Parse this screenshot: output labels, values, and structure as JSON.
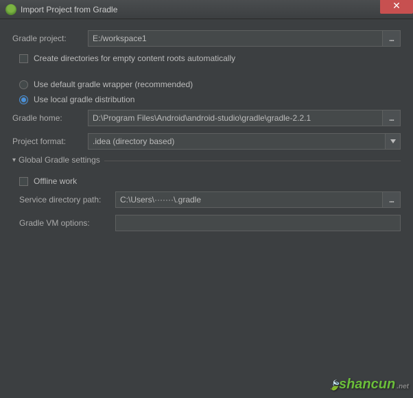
{
  "window": {
    "title": "Import Project from Gradle",
    "close": "✕"
  },
  "gradleProject": {
    "label": "Gradle project:",
    "value": "E:/workspace1",
    "browse": "..."
  },
  "createDirs": {
    "label": "Create directories for empty content roots automatically"
  },
  "wrapperOption": {
    "label": "Use default gradle wrapper (recommended)"
  },
  "localOption": {
    "label": "Use local gradle distribution"
  },
  "gradleHome": {
    "label": "Gradle home:",
    "value": "D:\\Program Files\\Android\\android-studio\\gradle\\gradle-2.2.1",
    "browse": "..."
  },
  "projectFormat": {
    "label": "Project format:",
    "value": ".idea (directory based)"
  },
  "globalSection": {
    "legend": "Global Gradle settings",
    "offline": {
      "label": "Offline work"
    },
    "serviceDir": {
      "label": "Service directory path:",
      "value": "C:\\Users\\·······\\.gradle",
      "browse": "..."
    },
    "vmOptions": {
      "label": "Gradle VM options:",
      "value": ""
    }
  },
  "watermark": {
    "text1": "shan",
    "text2": "cun",
    "net": ".net"
  }
}
